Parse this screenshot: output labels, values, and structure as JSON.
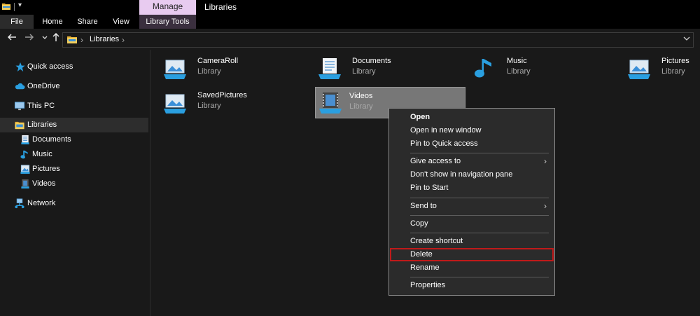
{
  "quick_access": {
    "dropdown_glyph": "▾"
  },
  "titlebar": {
    "contextual_tab": "Manage",
    "title": "Libraries"
  },
  "ribbon": {
    "tabs": [
      "File",
      "Home",
      "Share",
      "View",
      "Library Tools"
    ]
  },
  "address": {
    "path": "Libraries",
    "icons": [
      "back-arrow-icon",
      "forward-arrow-icon",
      "recent-dropdown-icon",
      "up-arrow-icon",
      "folder-icon",
      "chevron-right-icon",
      "dropdown-icon"
    ]
  },
  "sidebar": {
    "items": [
      {
        "label": "Quick access",
        "icon": "star-icon"
      },
      {
        "label": "OneDrive",
        "icon": "cloud-icon"
      },
      {
        "label": "This PC",
        "icon": "monitor-icon"
      },
      {
        "label": "Libraries",
        "icon": "libraries-folder-icon",
        "selected": true
      },
      {
        "label": "Documents",
        "icon": "documents-icon"
      },
      {
        "label": "Music",
        "icon": "music-note-icon"
      },
      {
        "label": "Pictures",
        "icon": "pictures-icon"
      },
      {
        "label": "Videos",
        "icon": "videos-icon"
      },
      {
        "label": "Network",
        "icon": "network-icon"
      }
    ]
  },
  "libraries": [
    {
      "name": "CameraRoll",
      "type": "Library",
      "icon": "pictures-library-icon"
    },
    {
      "name": "Documents",
      "type": "Library",
      "icon": "documents-library-icon"
    },
    {
      "name": "Music",
      "type": "Library",
      "icon": "music-library-icon"
    },
    {
      "name": "Pictures",
      "type": "Library",
      "icon": "pictures-library-icon"
    },
    {
      "name": "SavedPictures",
      "type": "Library",
      "icon": "pictures-library-icon"
    },
    {
      "name": "Videos",
      "type": "Library",
      "icon": "videos-library-icon",
      "selected": true
    }
  ],
  "context_menu": {
    "items": [
      {
        "label": "Open",
        "bold": true
      },
      {
        "label": "Open in new window"
      },
      {
        "label": "Pin to Quick access"
      },
      {
        "label": "Give access to",
        "submenu": true
      },
      {
        "label": "Don't show in navigation pane"
      },
      {
        "label": "Pin to Start"
      },
      {
        "label": "Send to",
        "submenu": true
      },
      {
        "label": "Copy"
      },
      {
        "label": "Create shortcut"
      },
      {
        "label": "Delete",
        "highlighted": true
      },
      {
        "label": "Rename"
      },
      {
        "label": "Properties"
      }
    ],
    "submenu_arrow": "›"
  },
  "colors": {
    "background": "#191919",
    "titlebar": "#000000",
    "manage_tab": "#e8cbf0",
    "selection": "#777777",
    "menu_bg": "#2b2b2b",
    "highlight_outline": "#c01a1a",
    "icon_blue": "#2a9fe0"
  }
}
